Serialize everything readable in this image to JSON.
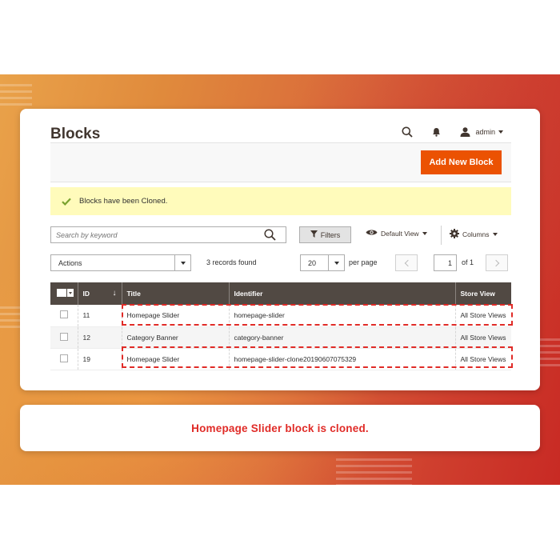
{
  "page": {
    "title": "Blocks",
    "admin_name": "admin",
    "add_button_label": "Add New Block"
  },
  "message": {
    "text": "Blocks have been Cloned."
  },
  "toolbar": {
    "search_placeholder": "Search by keyword",
    "filters_label": "Filters",
    "view_label": "Default View",
    "columns_label": "Columns",
    "actions_label": "Actions",
    "records_found": "3 records found",
    "per_page_value": "20",
    "per_page_label": "per page",
    "current_page": "1",
    "total_pages": "of 1"
  },
  "grid": {
    "columns": [
      "ID",
      "Title",
      "Identifier",
      "Store View"
    ],
    "sort_indicator": "↓",
    "rows": [
      {
        "id": "11",
        "title": "Homepage Slider",
        "identifier": "homepage-slider",
        "store_view": "All Store Views",
        "highlighted": true
      },
      {
        "id": "12",
        "title": "Category Banner",
        "identifier": "category-banner",
        "store_view": "All Store Views",
        "highlighted": false
      },
      {
        "id": "19",
        "title": "Homepage Slider",
        "identifier": "homepage-slider-clone20190607075329",
        "store_view": "All Store Views",
        "highlighted": true
      }
    ]
  },
  "caption": {
    "text": "Homepage Slider block is cloned."
  },
  "colors": {
    "accent": "#eb5202",
    "highlight": "#e02b27",
    "grid_header": "#514943",
    "message_bg": "#fffbbb"
  },
  "icons": [
    "search-icon",
    "bell-icon",
    "user-icon",
    "check-icon",
    "funnel-icon",
    "eye-icon",
    "gear-icon"
  ]
}
